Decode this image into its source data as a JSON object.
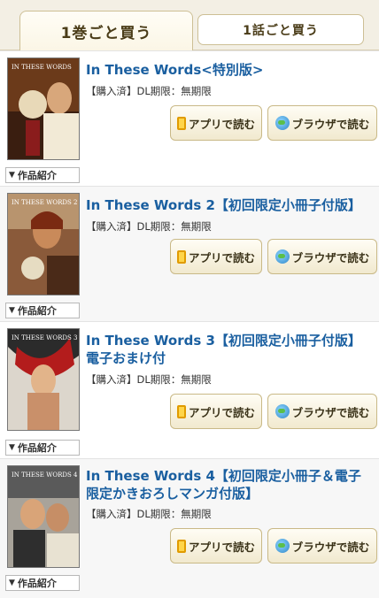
{
  "tabs": [
    {
      "label": "1巻ごと買う",
      "active": true
    },
    {
      "label": "1話ごと買う",
      "active": false
    }
  ],
  "buttons": {
    "app_read": "アプリで読む",
    "browser_read": "ブラウザで読む",
    "intro": "作品紹介"
  },
  "books": [
    {
      "title": "In These Words<特別版>",
      "status": "【購入済】DL期限：無期限",
      "cover_text": "IN THESE WORDS"
    },
    {
      "title": "In These Words 2【初回限定小冊子付版】",
      "status": "【購入済】DL期限：無期限",
      "cover_text": "IN THESE WORDS 2"
    },
    {
      "title": "In These Words 3【初回限定小冊子付版】電子おまけ付",
      "status": "【購入済】DL期限：無期限",
      "cover_text": "IN THESE WORDS 3"
    },
    {
      "title": "In These Words 4【初回限定小冊子＆電子限定かきおろしマンガ付版】",
      "status": "【購入済】DL期限：無期限",
      "cover_text": "IN THESE WORDS 4"
    }
  ],
  "colors": {
    "title": "#1a5fa0",
    "accent_tab": "#cdbf95",
    "button_border": "#c9b987"
  }
}
